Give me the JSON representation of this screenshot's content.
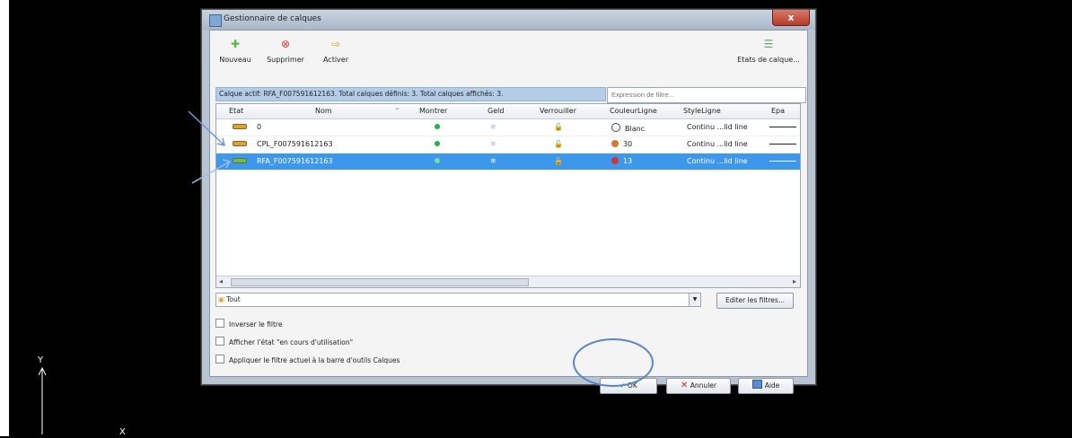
{
  "window": {
    "title": "Gestionnaire de calques",
    "close_glyph": "x"
  },
  "toolbar": {
    "new_label": "Nouveau",
    "new_icon": "new-layer-icon",
    "delete_label": "Supprimer",
    "delete_icon": "delete-icon",
    "activate_label": "Activer",
    "activate_icon": "activate-icon",
    "states_label": "Etats de calque..."
  },
  "status_line": "Calque actif: RFA_F007591612163. Total calques définis: 3. Total calques affichés: 3.",
  "filter": {
    "placeholder": "Expression de filtre..."
  },
  "columns": [
    "Etat",
    "Nom",
    "Montrer",
    "Geld",
    "Verrouiller",
    "CouleurLigne",
    "StyleLigne",
    "Epa"
  ],
  "layers": [
    {
      "name": "0",
      "color_label": "Blanc",
      "color": "#ffffff",
      "style": "Continu ...lid line",
      "selected": false
    },
    {
      "name": "CPL_F007591612163",
      "color_label": "30",
      "color": "#e0762a",
      "style": "Continu ...lid line",
      "selected": false
    },
    {
      "name": "RFA_F007591612163",
      "color_label": "13",
      "color": "#d23434",
      "style": "Continu ...lid line",
      "selected": true
    }
  ],
  "tree_filter": {
    "label": "Tout"
  },
  "edit_filters_label": "Editer les filtres...",
  "checkboxes": {
    "invert": "Inverser le filtre",
    "show_in_use": "Afficher l'état \"en cours d'utilisation\"",
    "apply_toolbar": "Appliquer le filtre actuel à la barre d'outils Calques"
  },
  "buttons": {
    "ok": "OK",
    "cancel": "Annuler",
    "help": "Aide"
  },
  "ucs": {
    "y_label": "Y",
    "x_label": "X"
  },
  "colors": {
    "selection": "#3d97ea",
    "accent_circle": "#5a86c6",
    "ok_check": "#2aa44a",
    "cancel_x": "#d52a24"
  }
}
